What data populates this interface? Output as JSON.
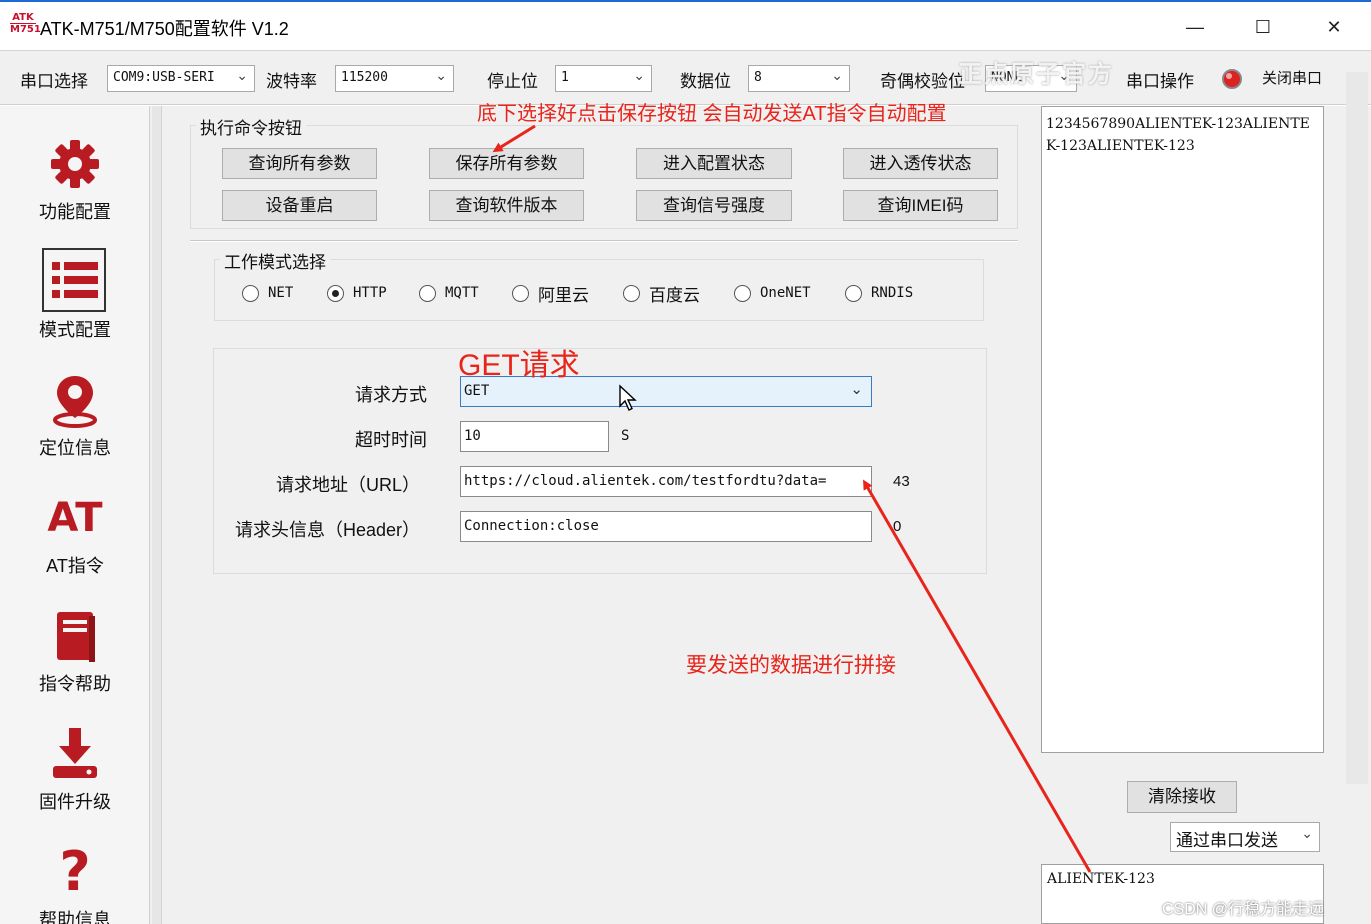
{
  "window": {
    "icon_text_top": "ATK",
    "icon_text_bottom": "M751",
    "title": "ATK-M751/M750配置软件 V1.2",
    "min_glyph": "—",
    "max_glyph": "☐",
    "close_glyph": "✕"
  },
  "toolbar": {
    "port_label": "串口选择",
    "port_value": "COM9:USB-SERI",
    "baud_label": "波特率",
    "baud_value": "115200",
    "stop_label": "停止位",
    "stop_value": "1",
    "data_label": "数据位",
    "data_value": "8",
    "parity_label": "奇偶校验位",
    "parity_value": "NONE",
    "serial_op_label": "串口操作",
    "close_port_label": "关闭串口"
  },
  "brand_overlay": "正点原子官方",
  "sidebar": {
    "items": [
      {
        "label": "功能配置",
        "icon": "gear-icon"
      },
      {
        "label": "模式配置",
        "icon": "list-icon"
      },
      {
        "label": "定位信息",
        "icon": "location-pin-icon"
      },
      {
        "label": "AT指令",
        "icon": "at-icon",
        "glyph": "AT"
      },
      {
        "label": "指令帮助",
        "icon": "book-icon"
      },
      {
        "label": "固件升级",
        "icon": "download-icon"
      },
      {
        "label": "帮助信息",
        "icon": "question-icon",
        "glyph": "?"
      }
    ],
    "active_index": 1
  },
  "commands": {
    "group_title": "执行命令按钮",
    "buttons": [
      "查询所有参数",
      "保存所有参数",
      "进入配置状态",
      "进入透传状态",
      "设备重启",
      "查询软件版本",
      "查询信号强度",
      "查询IMEI码"
    ]
  },
  "mode": {
    "group_title": "工作模式选择",
    "options": [
      "NET",
      "HTTP",
      "MQTT",
      "阿里云",
      "百度云",
      "OneNET",
      "RNDIS"
    ],
    "selected": "HTTP"
  },
  "http": {
    "method_label": "请求方式",
    "method_value": "GET",
    "timeout_label": "超时时间",
    "timeout_value": "10",
    "timeout_unit": "S",
    "url_label": "请求地址（URL）",
    "url_value": "https://cloud.alientek.com/testfordtu?data=",
    "url_length": "43",
    "header_label": "请求头信息（Header）",
    "header_value": "Connection:close",
    "header_length": "0"
  },
  "right_panel": {
    "recv_text": "1234567890ALIENTEK-123ALIENTEK-123ALIENTEK-123",
    "clear_button": "清除接收",
    "send_mode": "通过串口发送",
    "send_text": "ALIENTEK-123"
  },
  "annotations": {
    "save_hint": "底下选择好点击保存按钮  会自动发送AT指令自动配置",
    "get_hint": "GET请求",
    "concat_hint": "要发送的数据进行拼接",
    "color": "#e8241b"
  },
  "watermark": "CSDN @行稳方能走远",
  "colors": {
    "brand_red": "#b81c22",
    "title_accent": "#1f6bd6",
    "selected_field_border": "#3a78c8"
  }
}
